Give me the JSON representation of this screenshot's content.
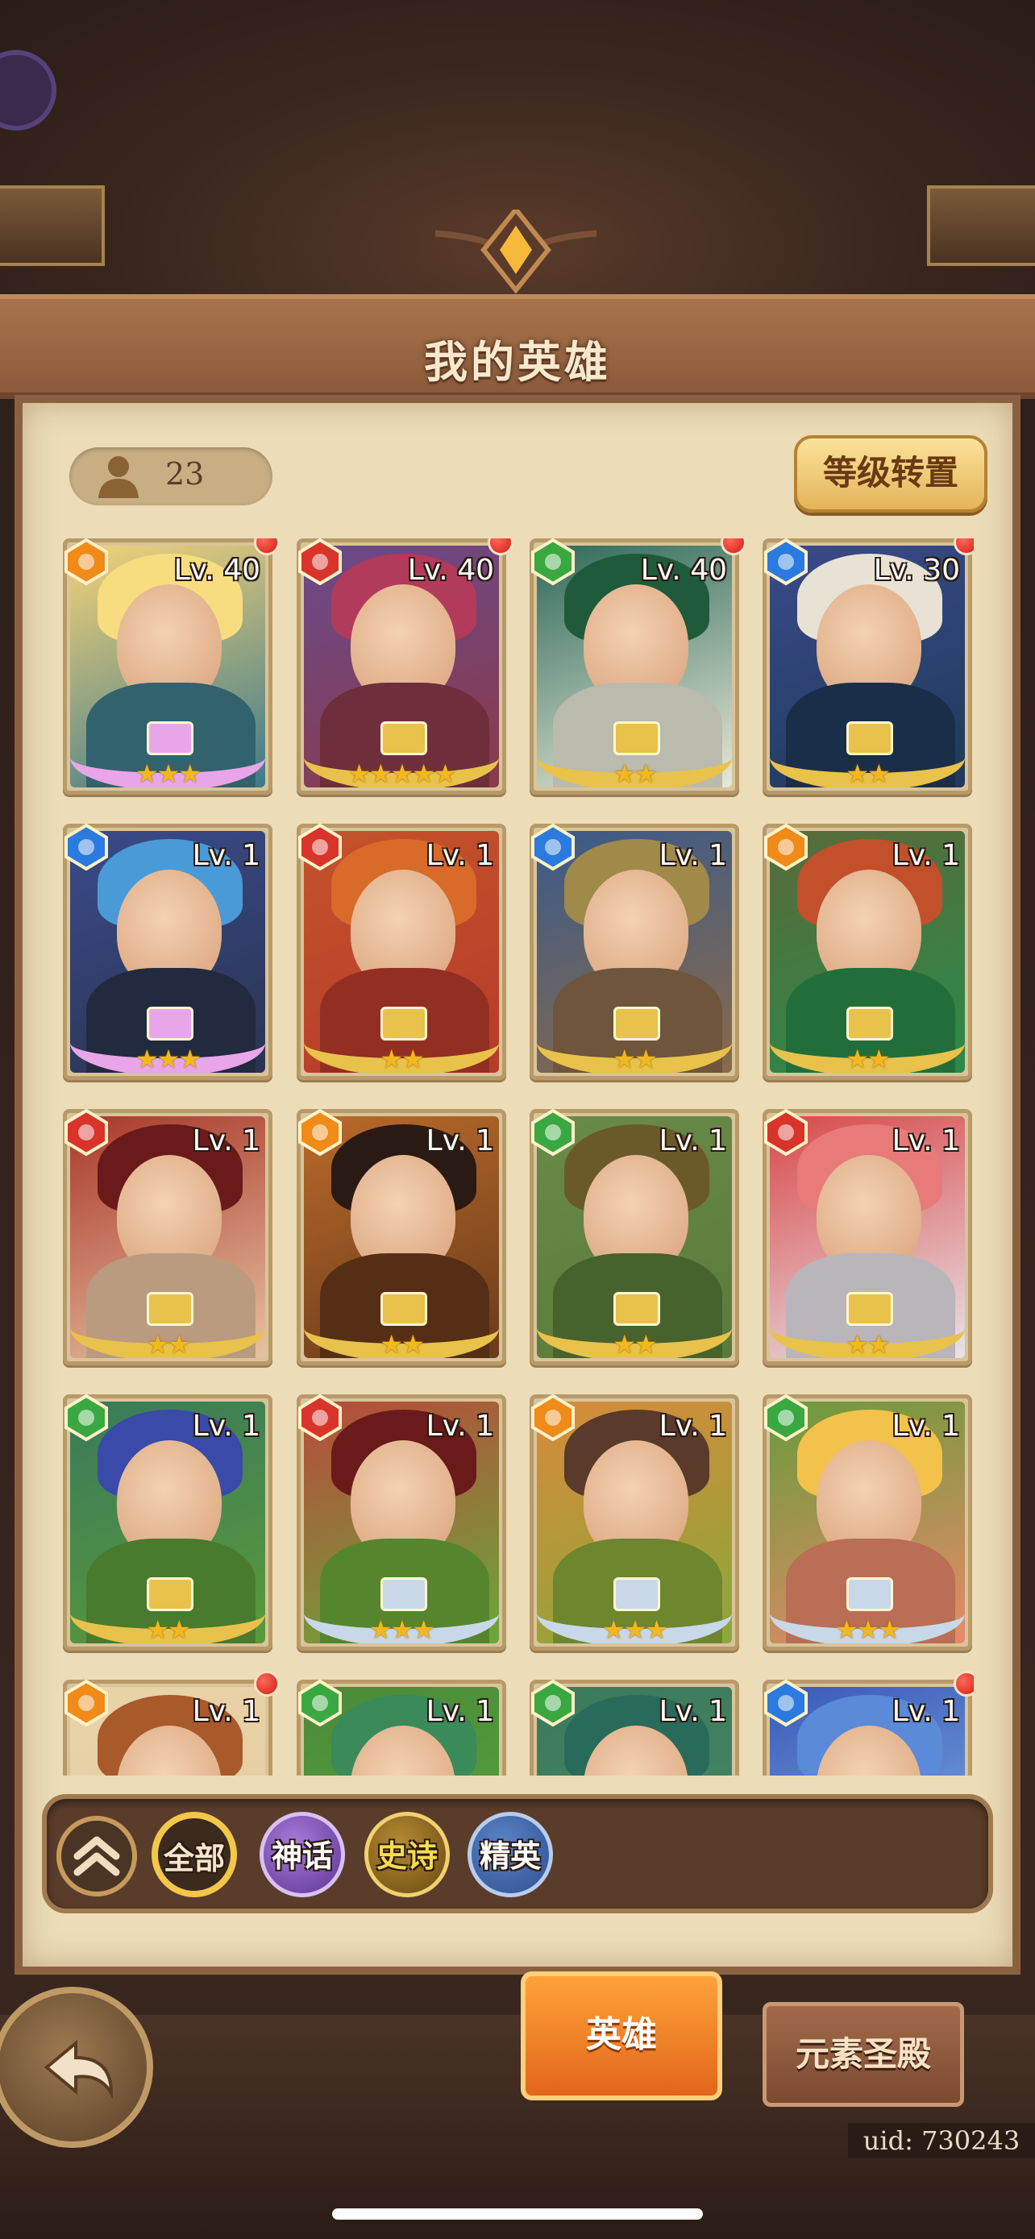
{
  "header": {
    "title": "我的英雄"
  },
  "summary": {
    "hero_count": "23",
    "transfer_button": "等级转置"
  },
  "elements": {
    "fire": "#d8342a",
    "water": "#2a7ae0",
    "nature": "#3aa840",
    "light": "#f08a18"
  },
  "heroes": [
    {
      "level": "Lv. 40",
      "element": "light",
      "stars": "★★★",
      "new": true,
      "palette": [
        "#f3d27a",
        "#f8dd80",
        "#3d7a8a"
      ],
      "frame": "#e8a6e8"
    },
    {
      "level": "Lv. 40",
      "element": "fire",
      "stars": "★★★★★",
      "new": true,
      "palette": [
        "#6a4a8a",
        "#b23a5a",
        "#8a3a4a"
      ],
      "frame": "#e8c24a"
    },
    {
      "level": "Lv. 40",
      "element": "nature",
      "stars": "★★",
      "new": true,
      "palette": [
        "#2f6a5a",
        "#1f5a3a",
        "#e8e8d8"
      ],
      "frame": "#e8c24a"
    },
    {
      "level": "Lv. 30",
      "element": "water",
      "stars": "★★",
      "new": true,
      "palette": [
        "#3a4a8a",
        "#e8e2d4",
        "#1f3a5a"
      ],
      "frame": "#e8c24a"
    },
    {
      "level": "Lv. 1",
      "element": "water",
      "stars": "★★★",
      "new": false,
      "palette": [
        "#3a4a8a",
        "#4a9ad8",
        "#2a3450"
      ],
      "frame": "#e8a6e8"
    },
    {
      "level": "Lv. 1",
      "element": "fire",
      "stars": "★★",
      "new": false,
      "palette": [
        "#c2542a",
        "#d86a2a",
        "#b83a2a"
      ],
      "frame": "#e8c24a"
    },
    {
      "level": "Lv. 1",
      "element": "water",
      "stars": "★★",
      "new": false,
      "palette": [
        "#3a5a8a",
        "#a08a4a",
        "#8a6a4a"
      ],
      "frame": "#e8c24a"
    },
    {
      "level": "Lv. 1",
      "element": "light",
      "stars": "★★",
      "new": false,
      "palette": [
        "#5a6a3a",
        "#c2502a",
        "#2a8a4a"
      ],
      "frame": "#e8c24a"
    },
    {
      "level": "Lv. 1",
      "element": "fire",
      "stars": "★★",
      "new": false,
      "palette": [
        "#a8382a",
        "#6a1a1a",
        "#e8c2a0"
      ],
      "frame": "#e8c24a"
    },
    {
      "level": "Lv. 1",
      "element": "light",
      "stars": "★★",
      "new": false,
      "palette": [
        "#b86a2a",
        "#2a1a14",
        "#6a3a1a"
      ],
      "frame": "#e8c24a"
    },
    {
      "level": "Lv. 1",
      "element": "nature",
      "stars": "★★",
      "new": false,
      "palette": [
        "#6a8a4a",
        "#6a5a2a",
        "#5a7a3a"
      ],
      "frame": "#e8c24a"
    },
    {
      "level": "Lv. 1",
      "element": "fire",
      "stars": "★★",
      "new": false,
      "palette": [
        "#d84a4a",
        "#e87a7a",
        "#e8e2e8"
      ],
      "frame": "#e8c24a"
    },
    {
      "level": "Lv. 1",
      "element": "nature",
      "stars": "★★",
      "new": false,
      "palette": [
        "#3a7a5a",
        "#3a4aa8",
        "#5a9a3a"
      ],
      "frame": "#e8c24a"
    },
    {
      "level": "Lv. 1",
      "element": "fire",
      "stars": "★★★",
      "new": false,
      "palette": [
        "#b84a3a",
        "#6a1a1a",
        "#6aa83a"
      ],
      "frame": "#c8d8e8"
    },
    {
      "level": "Lv. 1",
      "element": "light",
      "stars": "★★★",
      "new": false,
      "palette": [
        "#d88a3a",
        "#5a3a2a",
        "#8aa83a"
      ],
      "frame": "#c8d8e8"
    },
    {
      "level": "Lv. 1",
      "element": "nature",
      "stars": "★★★",
      "new": false,
      "palette": [
        "#6a9a3a",
        "#f2c24a",
        "#e88a6a"
      ],
      "frame": "#c8d8e8"
    },
    {
      "level": "Lv. 1",
      "element": "light",
      "stars": "",
      "new": true,
      "palette": [
        "#e8d4a8",
        "#a85a2a",
        "#e8c8a0"
      ],
      "frame": "#e8c24a"
    },
    {
      "level": "Lv. 1",
      "element": "nature",
      "stars": "",
      "new": false,
      "palette": [
        "#4a8a3a",
        "#3a8a5a",
        "#5aa83a"
      ],
      "frame": "#e8c24a"
    },
    {
      "level": "Lv. 1",
      "element": "nature",
      "stars": "",
      "new": false,
      "palette": [
        "#3a7a5a",
        "#2a6a5a",
        "#4a8a6a"
      ],
      "frame": "#e8c24a"
    },
    {
      "level": "Lv. 1",
      "element": "water",
      "stars": "",
      "new": true,
      "palette": [
        "#3a5ab8",
        "#5a8ad8",
        "#8ab8e8"
      ],
      "frame": "#e8c24a"
    }
  ],
  "filters": {
    "all": "全部",
    "myth": "神话",
    "epic": "史诗",
    "elite": "精英"
  },
  "tabs": {
    "heroes": "英雄",
    "temple": "元素圣殿"
  },
  "footer": {
    "uid": "uid: 730243"
  }
}
